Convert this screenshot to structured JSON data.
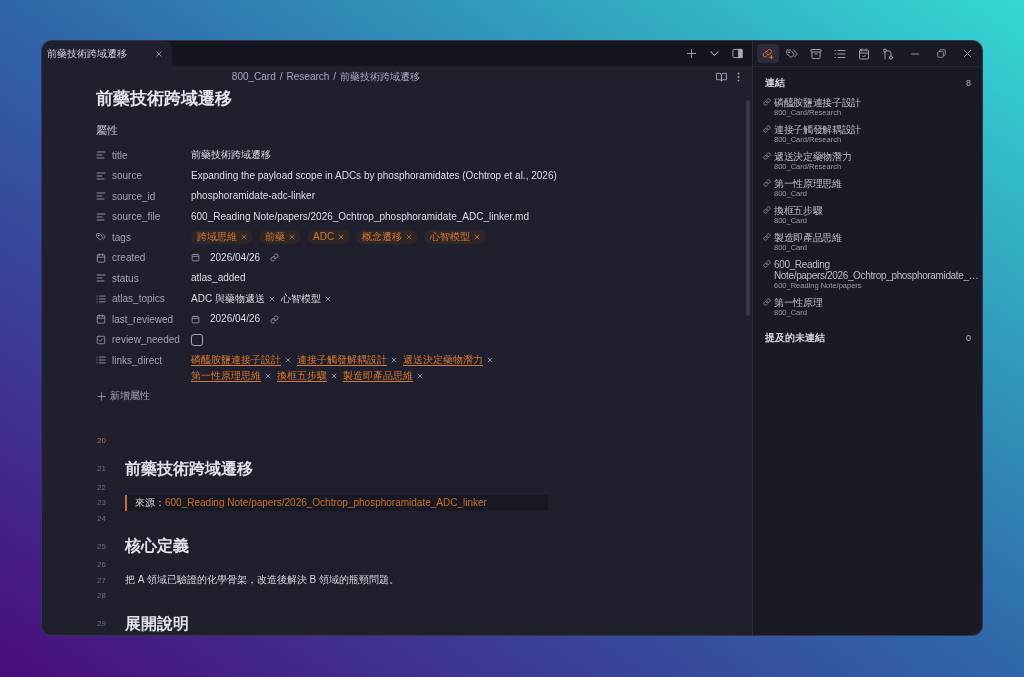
{
  "tabs": [
    {
      "title": "前藥技術跨域遷移",
      "selected": true
    }
  ],
  "breadcrumb": {
    "segments": [
      "800_Card",
      "Research",
      "前藥技術跨域遷移"
    ],
    "separator": "/"
  },
  "note": {
    "title": "前藥技術跨域遷移",
    "properties_heading": "屬性",
    "properties": [
      {
        "kind": "text",
        "key": "title",
        "value": "前藥技術跨域遷移"
      },
      {
        "kind": "text",
        "key": "source",
        "value": "Expanding the payload scope in ADCs by phosphoramidates (Ochtrop et al., 2026)"
      },
      {
        "kind": "text",
        "key": "source_id",
        "value": "phosphoramidate-adc-linker"
      },
      {
        "kind": "text",
        "key": "source_file",
        "value": "600_Reading Note/papers/2026_Ochtrop_phosphoramidate_ADC_linker.md"
      },
      {
        "kind": "tags",
        "key": "tags",
        "values": [
          "跨域思維",
          "前藥",
          "ADC",
          "概念遷移",
          "心智模型"
        ]
      },
      {
        "kind": "date",
        "key": "created",
        "value": "2026/04/26"
      },
      {
        "kind": "text",
        "key": "status",
        "value": "atlas_added"
      },
      {
        "kind": "list",
        "key": "atlas_topics",
        "values": [
          "ADC 與藥物遞送",
          "心智模型"
        ]
      },
      {
        "kind": "date",
        "key": "last_reviewed",
        "value": "2026/04/26"
      },
      {
        "kind": "checkbox",
        "key": "review_needed",
        "checked": false
      },
      {
        "kind": "links",
        "key": "links_direct",
        "values": [
          "磷醯胺鹽連接子設計",
          "連接子觸發解耦設計",
          "遞送決定藥物潛力",
          "第一性原理思維",
          "換框五步驟",
          "製造即產品思維"
        ]
      }
    ],
    "add_property": "新增屬性"
  },
  "editor": {
    "lines": [
      {
        "number": "20",
        "kind": "blank",
        "active": true
      },
      {
        "number": "21",
        "kind": "heading",
        "text": "前藥技術跨域遷移",
        "active": false
      },
      {
        "number": "22",
        "kind": "blank",
        "active": false
      },
      {
        "number": "23",
        "kind": "quote",
        "label": "來源：",
        "link": "600_Reading Note/papers/2026_Ochtrop_phosphoramidate_ADC_linker",
        "active": false
      },
      {
        "number": "24",
        "kind": "blank",
        "active": false
      },
      {
        "number": "25",
        "kind": "heading",
        "text": "核心定義",
        "active": false
      },
      {
        "number": "26",
        "kind": "blank",
        "active": false
      },
      {
        "number": "27",
        "kind": "text",
        "text": "把 A 領域已驗證的化學骨架，改造後解決 B 領域的瓶頸問題。",
        "active": false
      },
      {
        "number": "28",
        "kind": "blank",
        "active": false
      },
      {
        "number": "29",
        "kind": "heading",
        "text": "展開說明",
        "active": false
      }
    ]
  },
  "sidebar": {
    "tabs": [
      {
        "selected": true
      },
      {
        "selected": false
      },
      {
        "selected": false
      },
      {
        "selected": false
      },
      {
        "selected": false
      },
      {
        "selected": false
      }
    ],
    "links_heading": "連結",
    "links_count": "8",
    "links": [
      {
        "title": "磷醯胺鹽連接子設計",
        "path": "800_Card/Research"
      },
      {
        "title": "連接子觸發解耦設計",
        "path": "800_Card/Research"
      },
      {
        "title": "遞送決定藥物潛力",
        "path": "800_Card/Research"
      },
      {
        "title": "第一性原理思維",
        "path": "800_Card"
      },
      {
        "title": "換框五步驟",
        "path": "800_Card"
      },
      {
        "title": "製造即產品思維",
        "path": "800_Card"
      },
      {
        "title": "600_Reading Note/papers/2026_Ochtrop_phosphoramidate_…",
        "path": "600_Reading Note/papers"
      },
      {
        "title": "第一性原理",
        "path": "800_Card"
      }
    ],
    "unlinked_heading": "提及的未連結",
    "unlinked_count": "0"
  }
}
